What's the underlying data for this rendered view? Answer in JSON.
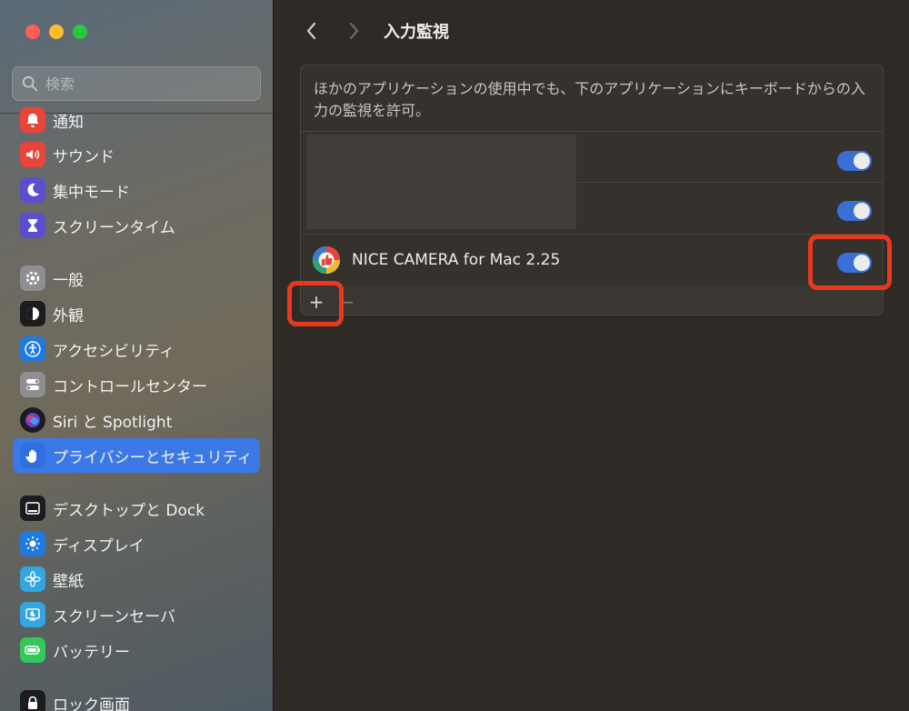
{
  "search": {
    "placeholder": "検索"
  },
  "sidebar": {
    "items": [
      {
        "label": "通知",
        "icon": "bell-icon",
        "color": "#e8443a"
      },
      {
        "label": "サウンド",
        "icon": "speaker-icon",
        "color": "#e8443a"
      },
      {
        "label": "集中モード",
        "icon": "moon-icon",
        "color": "#5a4fcf"
      },
      {
        "label": "スクリーンタイム",
        "icon": "hourglass-icon",
        "color": "#5a4fcf"
      },
      {
        "label": "一般",
        "icon": "gear-icon",
        "color": "#8e8e93"
      },
      {
        "label": "外観",
        "icon": "appearance-icon",
        "color": "#1c1c1e"
      },
      {
        "label": "アクセシビリティ",
        "icon": "accessibility-icon",
        "color": "#1f7ae0"
      },
      {
        "label": "コントロールセンター",
        "icon": "toggles-icon",
        "color": "#8e8e93"
      },
      {
        "label": "Siri と Spotlight",
        "icon": "siri-icon",
        "color": "#1c1c1e"
      },
      {
        "label": "プライバシーとセキュリティ",
        "icon": "hand-icon",
        "color": "#2f6fe0",
        "active": true
      },
      {
        "label": "デスクトップと Dock",
        "icon": "dock-icon",
        "color": "#1c1c1e"
      },
      {
        "label": "ディスプレイ",
        "icon": "sun-icon",
        "color": "#1f7ae0"
      },
      {
        "label": "壁紙",
        "icon": "flower-icon",
        "color": "#33a5e0"
      },
      {
        "label": "スクリーンセーバ",
        "icon": "screensaver-icon",
        "color": "#33a5e0"
      },
      {
        "label": "バッテリー",
        "icon": "battery-icon",
        "color": "#34c759"
      },
      {
        "label": "ロック画面",
        "icon": "lock-icon",
        "color": "#1c1c1e"
      }
    ]
  },
  "header": {
    "title": "入力監視"
  },
  "panel": {
    "description": "ほかのアプリケーションの使用中でも、下のアプリケーションにキーボードからの入力の監視を許可。",
    "apps": [
      {
        "name": "",
        "enabled": true
      },
      {
        "name": "",
        "enabled": true
      },
      {
        "name": "NICE CAMERA for Mac 2.25",
        "enabled": true
      }
    ],
    "add_label": "+",
    "remove_label": "−"
  },
  "colors": {
    "accent": "#3b79e6",
    "highlight": "#e8391f"
  }
}
